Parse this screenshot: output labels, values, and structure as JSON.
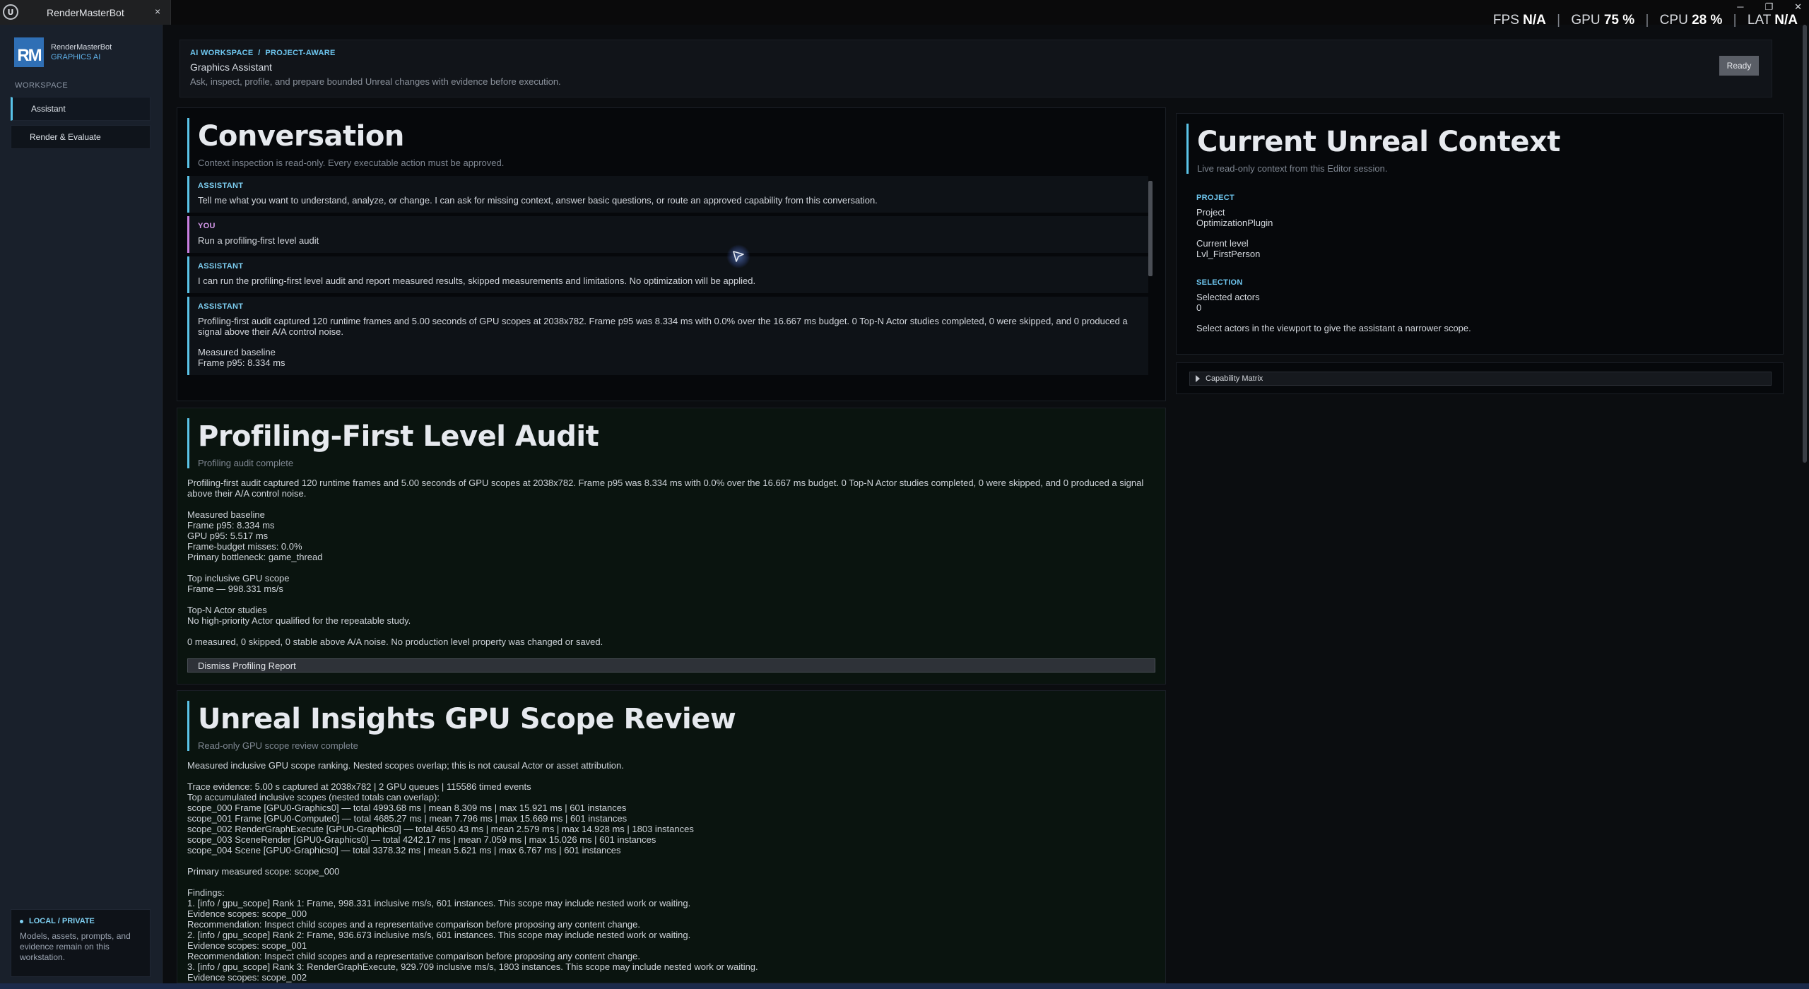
{
  "window": {
    "tab_title": "RenderMasterBot",
    "tab_close": "×",
    "logo_text": "U",
    "minimize": "─",
    "restore": "❐",
    "close": "✕"
  },
  "stats": {
    "fps_label": "FPS",
    "fps_value": "N/A",
    "gpu_label": "GPU",
    "gpu_value": "75 %",
    "cpu_label": "CPU",
    "cpu_value": "28 %",
    "lat_label": "LAT",
    "lat_value": "N/A",
    "sep": "|"
  },
  "sidebar": {
    "logo_text": "RM",
    "brand_name": "RenderMasterBot",
    "brand_sub": "GRAPHICS AI",
    "section_label": "WORKSPACE",
    "items": [
      {
        "label": "Assistant"
      },
      {
        "label": "Render & Evaluate"
      }
    ],
    "private_title": "LOCAL / PRIVATE",
    "private_text": "Models, assets, prompts, and evidence remain on this workstation."
  },
  "header": {
    "breadcrumb": "AI WORKSPACE  /  PROJECT-AWARE",
    "title": "Graphics Assistant",
    "subtitle": "Ask, inspect, profile, and prepare bounded Unreal changes with evidence before execution.",
    "status_button": "Ready"
  },
  "conversation": {
    "title": "Conversation",
    "subtitle": "Context inspection is read-only. Every executable action must be approved.",
    "messages": [
      {
        "role": "ASSISTANT",
        "text": "Tell me what you want to understand, analyze, or change. I can ask for missing context, answer basic questions, or route an approved capability from this conversation."
      },
      {
        "role": "YOU",
        "text": "Run a profiling-first level audit"
      },
      {
        "role": "ASSISTANT",
        "text": "I can run the profiling-first level audit and report measured results, skipped measurements and limitations. No optimization will be applied."
      },
      {
        "role": "ASSISTANT",
        "text": "Profiling-first audit captured 120 runtime frames and 5.00 seconds of GPU scopes at 2038x782. Frame p95 was 8.334 ms with 0.0% over the 16.667 ms budget. 0 Top-N Actor studies completed, 0 were skipped, and 0 produced a signal above their A/A control noise.",
        "extra1": "Measured baseline",
        "extra2": "Frame p95: 8.334 ms"
      }
    ]
  },
  "audit": {
    "title": "Profiling-First Level Audit",
    "subtitle": "Profiling audit complete",
    "summary": "Profiling-first audit captured 120 runtime frames and 5.00 seconds of GPU scopes at 2038x782. Frame p95 was 8.334 ms with 0.0% over the 16.667 ms budget. 0 Top-N Actor studies completed, 0 were skipped, and 0 produced a signal above their A/A control noise.",
    "baseline_head": "Measured baseline",
    "baseline": [
      "Frame p95: 8.334 ms",
      "GPU p95: 5.517 ms",
      "Frame-budget misses: 0.0%",
      "Primary bottleneck: game_thread"
    ],
    "gpu_head": "Top inclusive GPU scope",
    "gpu_line": "Frame — 998.331 ms/s",
    "actor_head": "Top-N Actor studies",
    "actor_line": "No high-priority Actor qualified for the repeatable study.",
    "footer": "0 measured, 0 skipped, 0 stable above A/A noise. No production level property was changed or saved.",
    "dismiss": "Dismiss Profiling Report"
  },
  "insights": {
    "title": "Unreal Insights GPU Scope Review",
    "subtitle": "Read-only GPU scope review complete",
    "intro": "Measured inclusive GPU scope ranking. Nested scopes overlap; this is not causal Actor or asset attribution.",
    "lines": [
      "Trace evidence: 5.00 s captured at 2038x782 | 2 GPU queues | 115586 timed events",
      "Top accumulated inclusive scopes (nested totals can overlap):",
      "scope_000  Frame [GPU0-Graphics0] — total 4993.68 ms | mean 8.309 ms | max 15.921 ms | 601 instances",
      "scope_001  Frame [GPU0-Compute0] — total 4685.27 ms | mean 7.796 ms | max 15.669 ms | 601 instances",
      "scope_002  RenderGraphExecute [GPU0-Graphics0] — total 4650.43 ms | mean 2.579 ms | max 14.928 ms | 1803 instances",
      "scope_003  SceneRender [GPU0-Graphics0] — total 4242.17 ms | mean 7.059 ms | max 15.026 ms | 601 instances",
      "scope_004  Scene [GPU0-Graphics0] — total 3378.32 ms | mean 5.621 ms | max 6.767 ms | 601 instances"
    ],
    "primary": "Primary measured scope: scope_000",
    "findings_head": "Findings:",
    "findings": [
      "1. [info / gpu_scope] Rank 1: Frame, 998.331 inclusive ms/s, 601 instances. This scope may include nested work or waiting.",
      "Evidence scopes: scope_000",
      "Recommendation: Inspect child scopes and a representative comparison before proposing any content change.",
      "2. [info / gpu_scope] Rank 2: Frame, 936.673 inclusive ms/s, 601 instances. This scope may include nested work or waiting.",
      "Evidence scopes: scope_001",
      "Recommendation: Inspect child scopes and a representative comparison before proposing any content change.",
      "3. [info / gpu_scope] Rank 3: RenderGraphExecute, 929.709 inclusive ms/s, 1803 instances. This scope may include nested work or waiting.",
      "Evidence scopes: scope_002"
    ]
  },
  "context": {
    "title": "Current Unreal Context",
    "subtitle": "Live read-only context from this Editor session.",
    "project_label": "PROJECT",
    "project_key": "Project",
    "project_value": "OptimizationPlugin",
    "level_key": "Current level",
    "level_value": "Lvl_FirstPerson",
    "selection_label": "SELECTION",
    "actors_key": "Selected actors",
    "actors_value": "0",
    "hint": "Select actors in the viewport to give the assistant a narrower scope."
  },
  "capability": {
    "label": "Capability Matrix"
  }
}
